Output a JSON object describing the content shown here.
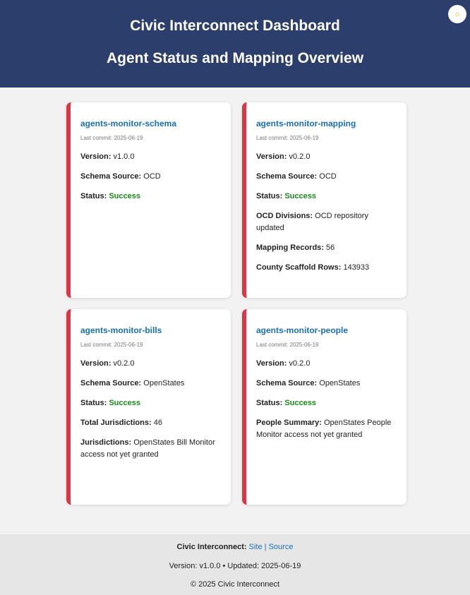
{
  "header": {
    "title": "Civic Interconnect Dashboard",
    "subtitle": "Agent Status and Mapping Overview",
    "theme_icon": "☼"
  },
  "labels": {
    "commit_prefix": "Last commit: ",
    "version": "Version:",
    "schema_source": "Schema Source:",
    "status": "Status:"
  },
  "cards": [
    {
      "title": "agents-monitor-schema",
      "commit": "2025-06-19",
      "version": "v1.0.0",
      "schema_source": "OCD",
      "status": "Success",
      "extras": []
    },
    {
      "title": "agents-monitor-mapping",
      "commit": "2025-06-19",
      "version": "v0.2.0",
      "schema_source": "OCD",
      "status": "Success",
      "extras": [
        {
          "label": "OCD Divisions:",
          "value": "OCD repository updated"
        },
        {
          "label": "Mapping Records:",
          "value": "56"
        },
        {
          "label": "County Scaffold Rows:",
          "value": "143933"
        }
      ]
    },
    {
      "title": "agents-monitor-bills",
      "commit": "2025-06-19",
      "version": "v0.2.0",
      "schema_source": "OpenStates",
      "status": "Success",
      "extras": [
        {
          "label": "Total Jurisdictions:",
          "value": "46"
        },
        {
          "label": "Jurisdictions:",
          "value": "OpenStates Bill Monitor access not yet granted"
        }
      ]
    },
    {
      "title": "agents-monitor-people",
      "commit": "2025-06-19",
      "version": "v0.2.0",
      "schema_source": "OpenStates",
      "status": "Success",
      "extras": [
        {
          "label": "People Summary:",
          "value": "OpenStates People Monitor access not yet granted"
        }
      ]
    }
  ],
  "footer": {
    "org_label": "Civic Interconnect:",
    "site_link": "Site",
    "separator": "|",
    "source_link": "Source",
    "version_line": "Version: v1.0.0 • Updated: 2025-06-19",
    "copyright": "© 2025 Civic Interconnect"
  },
  "colors": {
    "header_bg": "#2c3e6b",
    "card_accent": "#dc3545",
    "link": "#1a6fb5",
    "success": "#1a8a1a"
  }
}
